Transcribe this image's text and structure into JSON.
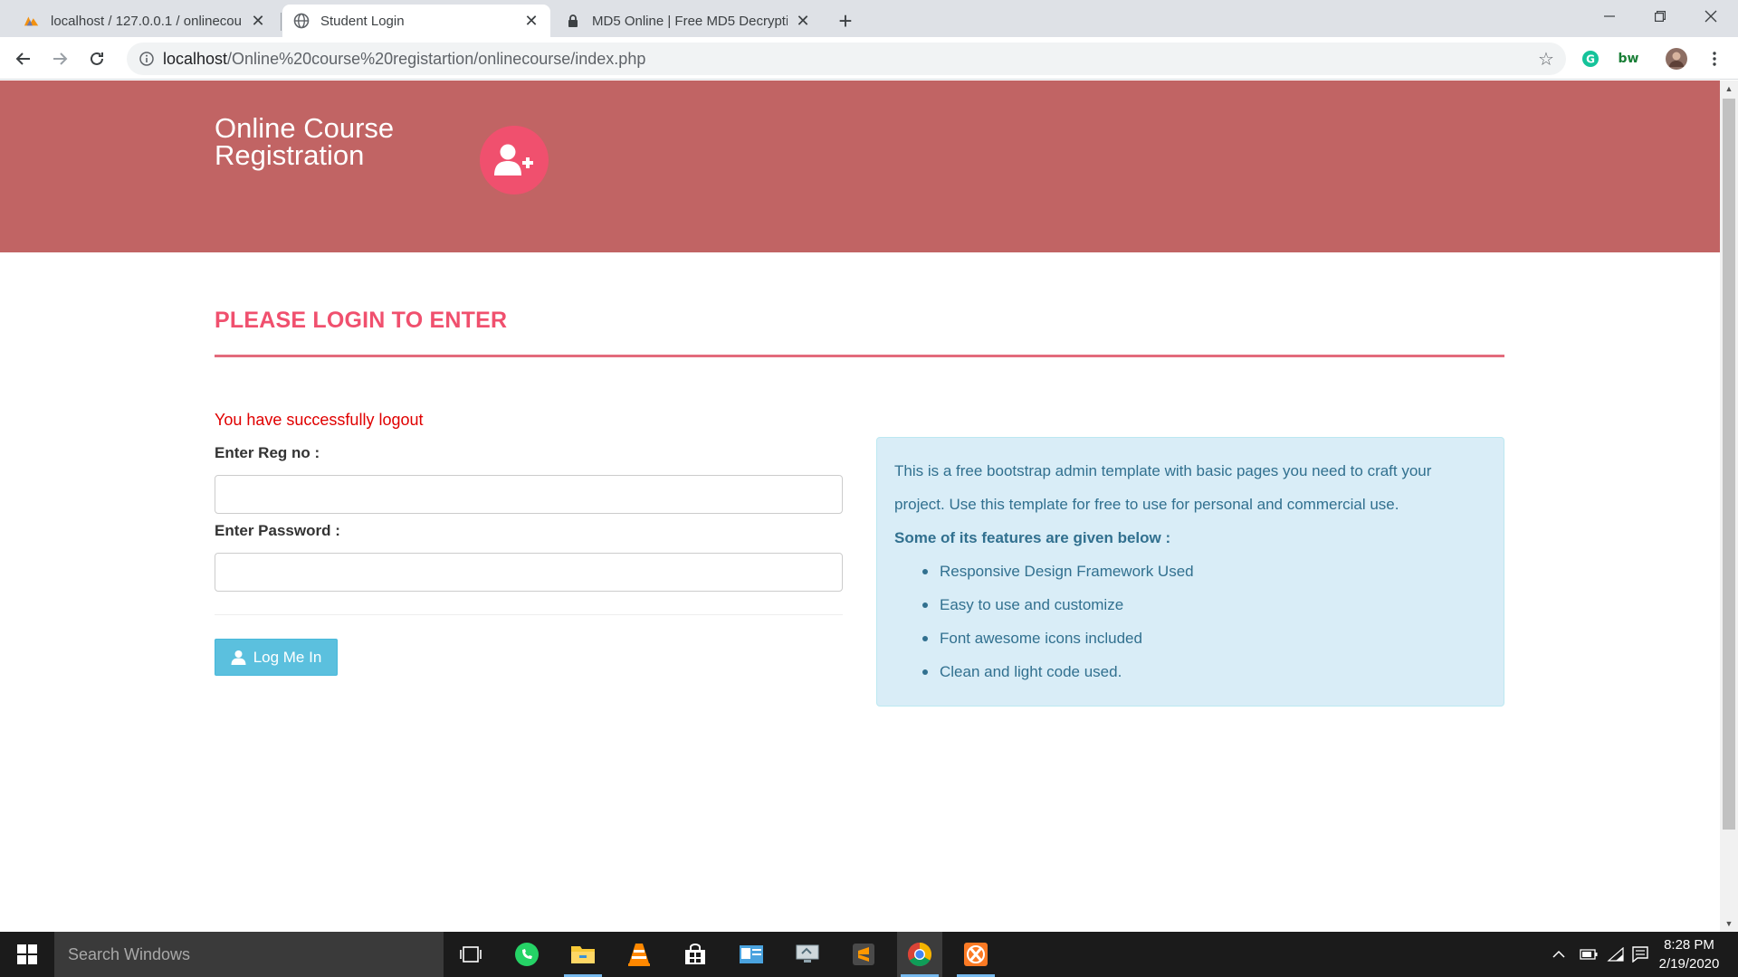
{
  "browser": {
    "tabs": [
      {
        "title": "localhost / 127.0.0.1 / onlinecour",
        "active": false,
        "icon": "phpmyadmin-icon"
      },
      {
        "title": "Student Login",
        "active": true,
        "icon": "globe-icon"
      },
      {
        "title": "MD5 Online | Free MD5 Decryptio",
        "active": false,
        "icon": "lock-icon"
      }
    ],
    "url_host": "localhost",
    "url_path": "/Online%20course%20registartion/onlinecourse/index.php"
  },
  "header": {
    "brand_line1": "Online Course",
    "brand_line2": "Registration",
    "brand_icon": "user-plus-icon"
  },
  "page": {
    "title": "PLEASE LOGIN TO ENTER",
    "status_message": "You have successfully logout",
    "reg_label": "Enter Reg no :",
    "reg_value": "",
    "password_label": "Enter Password :",
    "password_value": "",
    "login_button": "Log Me In"
  },
  "info": {
    "intro_line1": "This is a free bootstrap admin template with basic pages you need to craft your",
    "intro_line2": "project. Use this template for free to use for personal and commercial use.",
    "features_heading": "Some of its features are given below :",
    "features": [
      "Responsive Design Framework Used",
      "Easy to use and customize",
      "Font awesome icons included",
      "Clean and light code used."
    ]
  },
  "taskbar": {
    "search_placeholder": "Search Windows",
    "time": "8:28 PM",
    "date": "2/19/2020"
  },
  "colors": {
    "header_bg": "#c16464",
    "accent_pink": "#f0506e",
    "error_red": "#e00000",
    "button_info": "#5bc0de",
    "info_bg": "#d9edf7",
    "info_text": "#31708f"
  }
}
